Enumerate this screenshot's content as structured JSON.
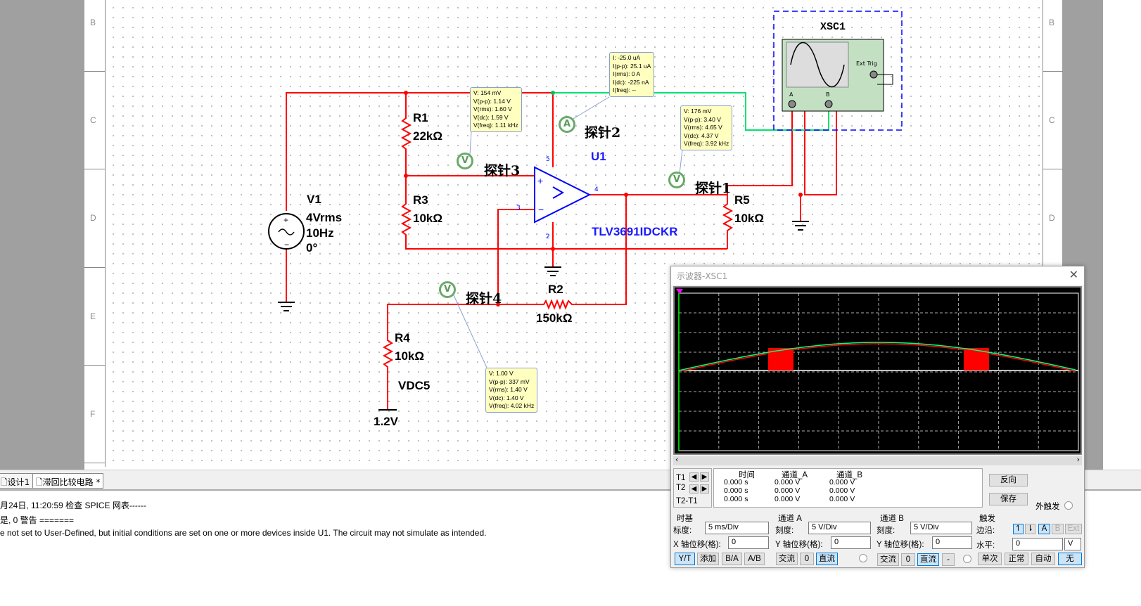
{
  "sheet": {
    "row_letters": [
      "B",
      "C",
      "D",
      "E",
      "F"
    ]
  },
  "components": {
    "v1": {
      "name": "V1",
      "value": "4Vrms",
      "freq": "10Hz",
      "phase": "0°"
    },
    "r1": {
      "name": "R1",
      "value": "22kΩ"
    },
    "r3": {
      "name": "R3",
      "value": "10kΩ"
    },
    "r5": {
      "name": "R5",
      "value": "10kΩ"
    },
    "r2": {
      "name": "R2",
      "value": "150kΩ"
    },
    "r4": {
      "name": "R4",
      "value": "10kΩ"
    },
    "vdc": {
      "name": "VDC5",
      "value": "1.2V"
    },
    "u1": {
      "name": "U1",
      "part": "TLV3691IDCKR",
      "pins": {
        "p5": "5",
        "p4": "4",
        "p3": "3",
        "p2": "2"
      }
    },
    "xsc1": {
      "name": "XSC1",
      "ext_trig": "Ext Trig",
      "a": "A",
      "b": "B"
    }
  },
  "probes": [
    {
      "label": "探针3",
      "glyph": "V",
      "lines": [
        "V: 154 mV",
        "V(p-p): 1.14 V",
        "V(rms): 1.60 V",
        "V(dc): 1.59 V",
        "V(freq): 1.11 kHz"
      ]
    },
    {
      "label": "探针2",
      "glyph": "A",
      "lines": [
        "I: -25.0 uA",
        "I(p-p): 25.1 uA",
        "I(rms): 0 A",
        "I(dc): -225 nA",
        "I(freq): --"
      ]
    },
    {
      "label": "探针1",
      "glyph": "V",
      "lines": [
        "V: 176 mV",
        "V(p-p): 3.40 V",
        "V(rms): 4.65 V",
        "V(dc): 4.37 V",
        "V(freq): 3.92 kHz"
      ]
    },
    {
      "label": "探针4",
      "glyph": "V",
      "lines": [
        "V: 1.00 V",
        "V(p-p): 337 mV",
        "V(rms): 1.40 V",
        "V(dc): 1.40 V",
        "V(freq): 4.02 kHz"
      ]
    }
  ],
  "tabs": [
    {
      "label": "设计1"
    },
    {
      "label": "滞回比较电路 *"
    }
  ],
  "output": [
    "月24日, 11:20:59 检查 SPICE 网表------",
    "是, 0 警告 =======",
    "e not set to User-Defined, but initial conditions are set on one or more devices inside U1. The circuit may not simulate as intended."
  ],
  "scope": {
    "title": "示波器-XSC1",
    "close": "✕",
    "colors": {
      "channel_a": "#ff0000",
      "channel_b": "#00ff80"
    },
    "readout": {
      "rows": [
        "T1",
        "T2",
        "T2-T1"
      ],
      "headers": [
        "时间",
        "通道_A",
        "通道_B"
      ],
      "values": [
        [
          "0.000 s",
          "0.000 V",
          "0.000 V"
        ],
        [
          "0.000 s",
          "0.000 V",
          "0.000 V"
        ],
        [
          "0.000 s",
          "0.000 V",
          "0.000 V"
        ]
      ]
    },
    "reverse": "反向",
    "save": "保存",
    "ext_trigger": "外触发",
    "timebase": {
      "title": "时基",
      "scale_label": "标度:",
      "scale": "5 ms/Div",
      "xpos_label": "X 轴位移(格):",
      "xpos": "0",
      "buttons": [
        "Y/T",
        "添加",
        "B/A",
        "A/B"
      ]
    },
    "channel_a": {
      "title": "通道 A",
      "scale_label": "刻度:",
      "scale": "5  V/Div",
      "ypos_label": "Y 轴位移(格):",
      "ypos": "0",
      "buttons": [
        "交流",
        "0",
        "直流"
      ]
    },
    "channel_b": {
      "title": "通道 B",
      "scale_label": "刻度:",
      "scale": "5  V/Div",
      "ypos_label": "Y 轴位移(格):",
      "ypos": "0",
      "buttons": [
        "交流",
        "0",
        "直流",
        "-"
      ]
    },
    "trigger": {
      "title": "触发",
      "edge_label": "边沿:",
      "edge_buttons": [
        "↿",
        "⇂",
        "A",
        "B",
        "Ext"
      ],
      "level_label": "水平:",
      "level": "0",
      "level_unit": "V",
      "mode_buttons": [
        "单次",
        "正常",
        "自动",
        "无"
      ]
    }
  }
}
